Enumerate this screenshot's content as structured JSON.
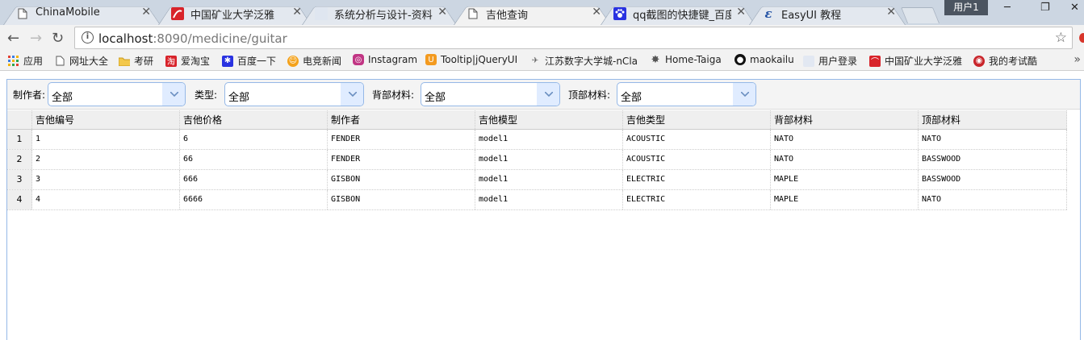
{
  "browser": {
    "tabs": [
      {
        "title": "ChinaMobile",
        "icon": "page-icon",
        "close": "✕"
      },
      {
        "title": "中国矿业大学泛雅",
        "icon": "chaoxing-icon",
        "close": "✕"
      },
      {
        "title": "系统分析与设计-资料",
        "icon": "blank-icon",
        "close": "✕"
      },
      {
        "title": "吉他查询",
        "icon": "page-icon",
        "close": "✕",
        "active": true
      },
      {
        "title": "qq截图的快捷键_百度搜",
        "icon": "baidu-icon",
        "close": "✕"
      },
      {
        "title": "EasyUI 教程",
        "icon": "easyui-icon",
        "close": "✕"
      }
    ],
    "profile": "用户1",
    "address": {
      "host": "localhost",
      "path": ":8090/medicine/guitar"
    },
    "bookmarks": [
      {
        "label": "应用",
        "icon": "apps-icon"
      },
      {
        "label": "网址大全",
        "icon": "page-icon"
      },
      {
        "label": "考研",
        "icon": "folder-icon"
      },
      {
        "label": "爱淘宝",
        "icon": "taobao-icon"
      },
      {
        "label": "百度一下",
        "icon": "baidu-icon"
      },
      {
        "label": "电竞新闻",
        "icon": "esports-icon"
      },
      {
        "label": "Instagram",
        "icon": "instagram-icon"
      },
      {
        "label": "Tooltip|jQueryUI",
        "icon": "jqueryui-icon"
      },
      {
        "label": "江苏数字大学城-nCla",
        "icon": "telescope-icon"
      },
      {
        "label": "Home-Taiga",
        "icon": "taiga-icon"
      },
      {
        "label": "maokailu",
        "icon": "github-icon"
      },
      {
        "label": "用户登录",
        "icon": "blank-icon"
      },
      {
        "label": "中国矿业大学泛雅",
        "icon": "chaoxing-icon"
      },
      {
        "label": "我的考试酷",
        "icon": "exam-icon"
      }
    ]
  },
  "filters": [
    {
      "label": "制作者:",
      "value": "全部"
    },
    {
      "label": "类型:",
      "value": "全部"
    },
    {
      "label": "背部材料:",
      "value": "全部"
    },
    {
      "label": "顶部材料:",
      "value": "全部"
    }
  ],
  "table": {
    "columns": [
      "吉他编号",
      "吉他价格",
      "制作者",
      "吉他模型",
      "吉他类型",
      "背部材料",
      "顶部材料"
    ],
    "rows": [
      {
        "n": "1",
        "cells": [
          "1",
          "6",
          "FENDER",
          "model1",
          "ACOUSTIC",
          "NATO",
          "NATO"
        ]
      },
      {
        "n": "2",
        "cells": [
          "2",
          "66",
          "FENDER",
          "model1",
          "ACOUSTIC",
          "NATO",
          "BASSWOOD"
        ]
      },
      {
        "n": "3",
        "cells": [
          "3",
          "666",
          "GISBON",
          "model1",
          "ELECTRIC",
          "MAPLE",
          "BASSWOOD"
        ]
      },
      {
        "n": "4",
        "cells": [
          "4",
          "6666",
          "GISBON",
          "model1",
          "ELECTRIC",
          "MAPLE",
          "NATO"
        ]
      }
    ]
  },
  "colors": {
    "accent": "#95b8e7",
    "combo_arrow_bg": "#e0ecff",
    "header_bg": "#efefef"
  }
}
